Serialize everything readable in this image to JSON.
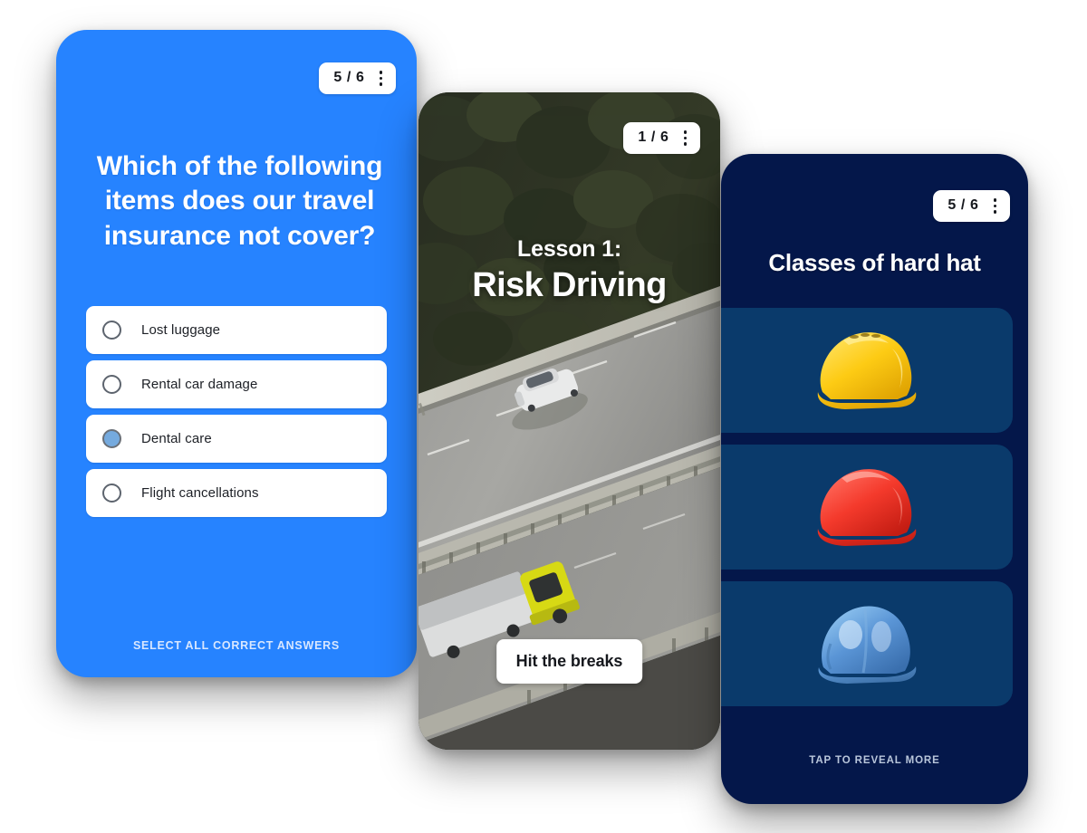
{
  "cards": [
    {
      "id": "quiz",
      "badge": {
        "count": "5 / 6",
        "menu_icon": "kebab-menu-icon"
      },
      "question": "Which of the following items does our travel insurance not cover?",
      "options": [
        {
          "label": "Lost luggage",
          "selected": false
        },
        {
          "label": "Rental car damage",
          "selected": false
        },
        {
          "label": "Dental care",
          "selected": true
        },
        {
          "label": "Flight cancellations",
          "selected": false
        }
      ],
      "footer": "SELECT ALL CORRECT ANSWERS",
      "background_color": "#2683ff"
    },
    {
      "id": "lesson",
      "badge": {
        "count": "1 / 6",
        "menu_icon": "kebab-menu-icon"
      },
      "eyebrow": "Lesson 1:",
      "title": "Risk Driving",
      "cta_label": "Hit the breaks",
      "image_description": "aerial-highway-photo"
    },
    {
      "id": "hats",
      "badge": {
        "count": "5 / 6",
        "menu_icon": "kebab-menu-icon"
      },
      "title": "Classes of hard hat",
      "panels": [
        {
          "icon": "hard-hat-icon",
          "color": "#f5c518"
        },
        {
          "icon": "hard-hat-icon",
          "color": "#f0372d"
        },
        {
          "icon": "hard-hat-icon",
          "color": "#5f9ede"
        }
      ],
      "footer": "TAP TO REVEAL MORE",
      "background_color": "#04174a",
      "panel_color": "#0a3a6b"
    }
  ]
}
